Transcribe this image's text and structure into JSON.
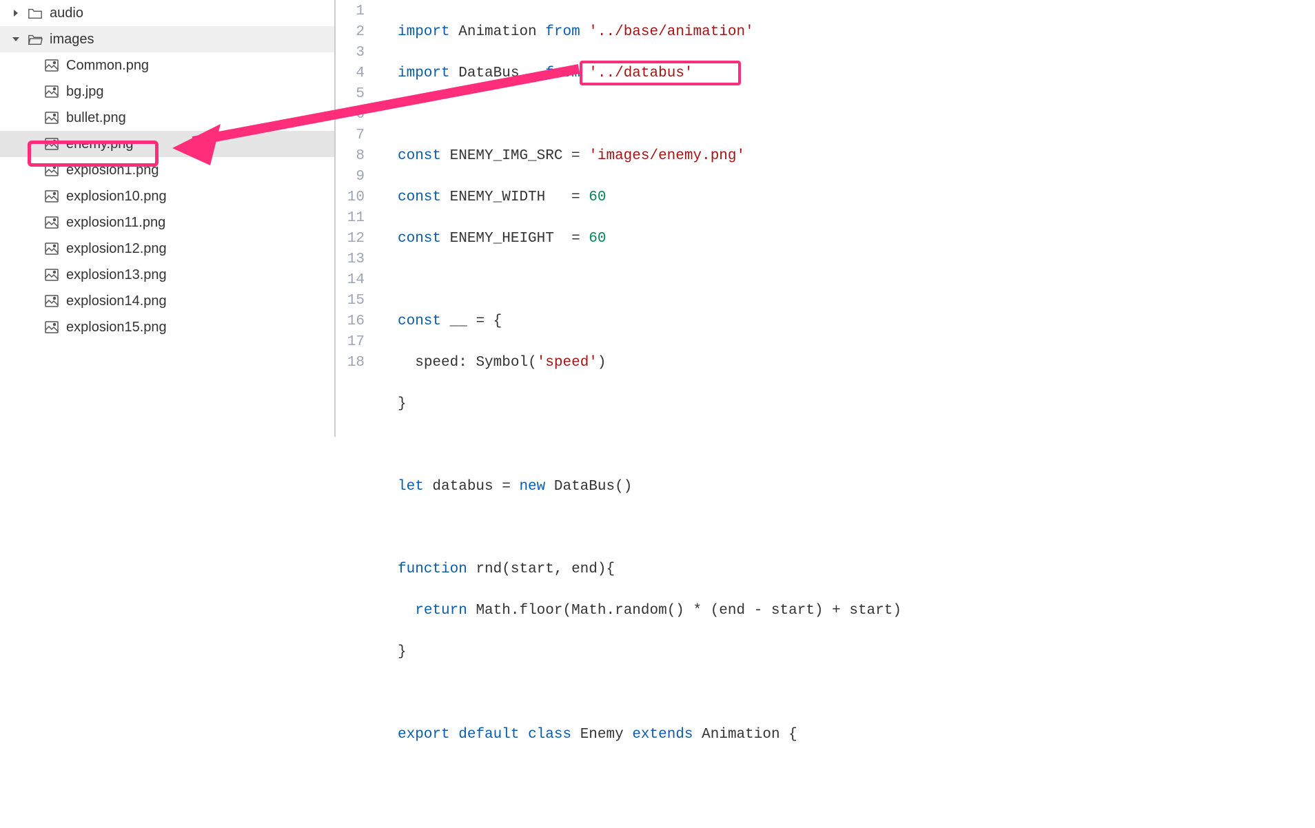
{
  "sidebar": {
    "items": [
      {
        "label": "audio",
        "type": "folder",
        "depth": 0,
        "expanded": false
      },
      {
        "label": "images",
        "type": "folder",
        "depth": 0,
        "expanded": true
      },
      {
        "label": "Common.png",
        "type": "image",
        "depth": 1
      },
      {
        "label": "bg.jpg",
        "type": "image",
        "depth": 1
      },
      {
        "label": "bullet.png",
        "type": "image",
        "depth": 1
      },
      {
        "label": "enemy.png",
        "type": "image",
        "depth": 1,
        "selected": true
      },
      {
        "label": "explosion1.png",
        "type": "image",
        "depth": 1
      },
      {
        "label": "explosion10.png",
        "type": "image",
        "depth": 1
      },
      {
        "label": "explosion11.png",
        "type": "image",
        "depth": 1
      },
      {
        "label": "explosion12.png",
        "type": "image",
        "depth": 1
      },
      {
        "label": "explosion13.png",
        "type": "image",
        "depth": 1
      },
      {
        "label": "explosion14.png",
        "type": "image",
        "depth": 1
      },
      {
        "label": "explosion15.png",
        "type": "image",
        "depth": 1
      }
    ]
  },
  "code": {
    "tokens": {
      "import": "import",
      "from": "from",
      "const": "const",
      "let": "let",
      "new": "new",
      "function": "function",
      "return": "return",
      "export": "export",
      "default": "default",
      "class": "class",
      "extends": "extends"
    },
    "line1_name": "Animation",
    "line1_str": "'../base/animation'",
    "line2_name": "DataBus",
    "line2_str": "'../databus'",
    "line4_var": "ENEMY_IMG_SRC",
    "line4_str": "'images/enemy.png'",
    "line5_var": "ENEMY_WIDTH",
    "line5_val": "60",
    "line6_var": "ENEMY_HEIGHT",
    "line6_val": "60",
    "line8_var": "__",
    "line9_key": "speed",
    "line9_call": "Symbol",
    "line9_str": "'speed'",
    "line12_var": "databus",
    "line12_class": "DataBus",
    "line14_fn": "rnd",
    "line14_params": "start, end",
    "line15_expr1": "Math.floor(Math.random() * (end - start) + start)",
    "line18_class": "Enemy",
    "line18_super": "Animation"
  },
  "annotation": {
    "color": "#ff2d7a"
  }
}
